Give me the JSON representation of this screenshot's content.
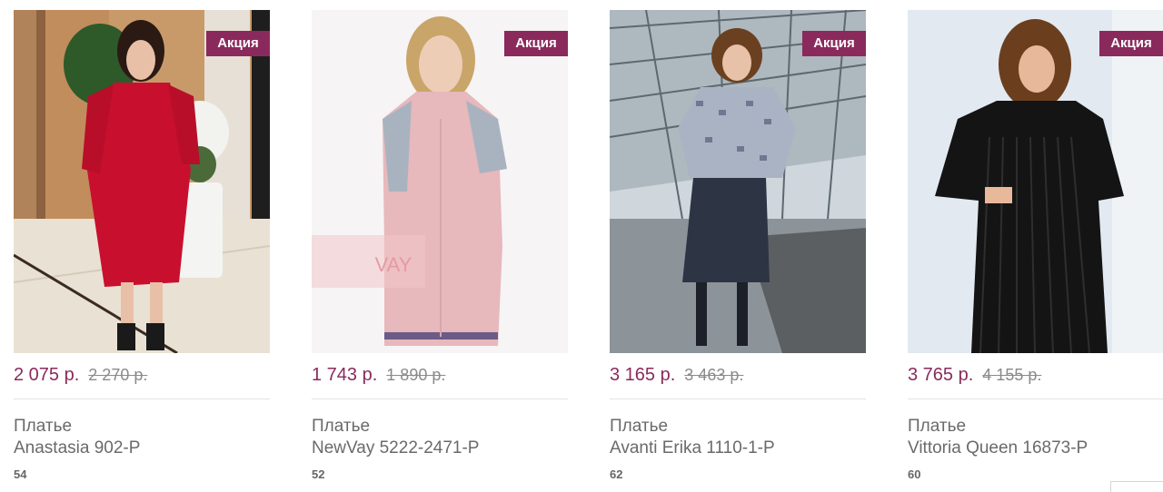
{
  "products": [
    {
      "badge": "Акция",
      "price": "2 075 р.",
      "old_price": "2 270 р.",
      "type": "Платье",
      "name": "Anastasia 902-Р",
      "size": "54"
    },
    {
      "badge": "Акция",
      "price": "1 743 р.",
      "old_price": "1 890 р.",
      "type": "Платье",
      "name": "NewVay 5222-2471-Р",
      "size": "52",
      "watermark": "VAY"
    },
    {
      "badge": "Акция",
      "price": "3 165 р.",
      "old_price": "3 463 р.",
      "type": "Платье",
      "name": "Avanti Erika 1110-1-Р",
      "size": "62"
    },
    {
      "badge": "Акция",
      "price": "3 765 р.",
      "old_price": "4 155 р.",
      "type": "Платье",
      "name": "Vittoria Queen 16873-Р",
      "size": "60"
    }
  ],
  "colors": {
    "accent": "#8a2a5c",
    "muted_text": "#6a6a6a"
  }
}
